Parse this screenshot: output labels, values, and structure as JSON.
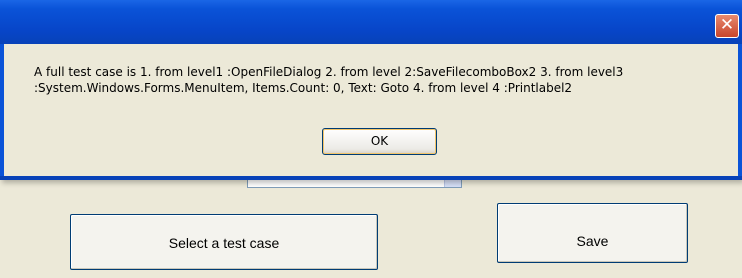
{
  "background_window": {
    "combo_value": "",
    "select_button_label": "Select a test case",
    "save_button_label": "Save"
  },
  "dialog": {
    "close_label": "✕",
    "message_line1": "A full test case is 1. from level1 :OpenFileDialog  2. from level 2:SaveFilecomboBox2  3. from level3",
    "message_line2": ":System.Windows.Forms.MenuItem, Items.Count: 0, Text: Goto   4. from level 4 :Printlabel2",
    "ok_label": "OK"
  },
  "colors": {
    "titlebar": "#0a53d8",
    "close_button": "#c8452c",
    "dialog_background": "#ece9d8"
  }
}
